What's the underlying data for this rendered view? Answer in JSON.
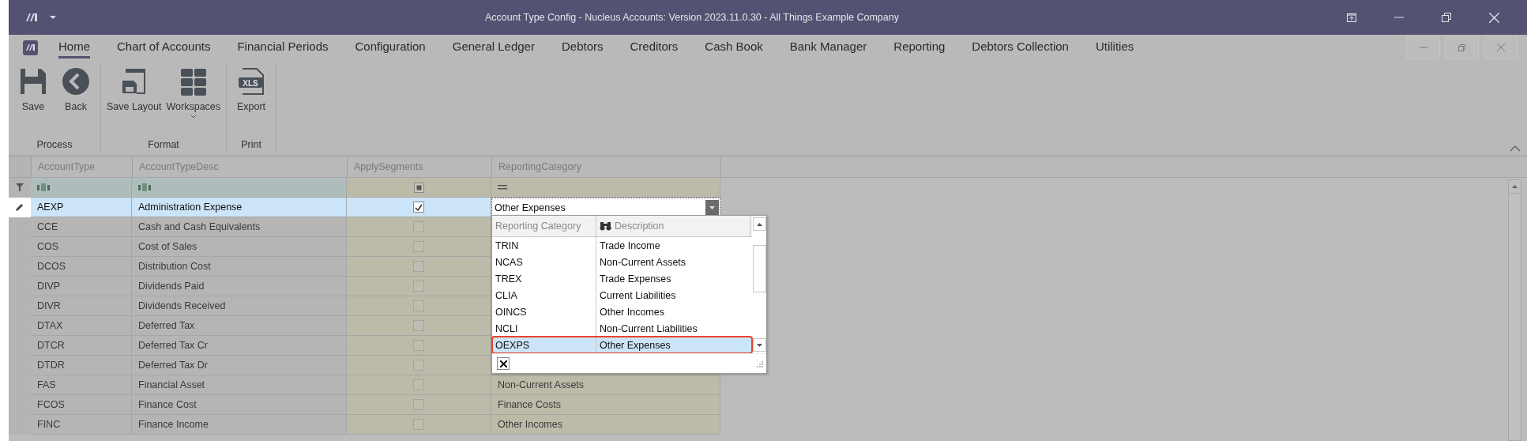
{
  "window": {
    "title": "Account Type Config - Nucleus Accounts: Version 2023.11.0.30 - All Things Example Company"
  },
  "menu": {
    "tabs": [
      {
        "label": "Home",
        "selected": true
      },
      {
        "label": "Chart of Accounts",
        "selected": false
      },
      {
        "label": "Financial Periods",
        "selected": false
      },
      {
        "label": "Configuration",
        "selected": false
      },
      {
        "label": "General Ledger",
        "selected": false
      },
      {
        "label": "Debtors",
        "selected": false
      },
      {
        "label": "Creditors",
        "selected": false
      },
      {
        "label": "Cash Book",
        "selected": false
      },
      {
        "label": "Bank Manager",
        "selected": false
      },
      {
        "label": "Reporting",
        "selected": false
      },
      {
        "label": "Debtors Collection",
        "selected": false
      },
      {
        "label": "Utilities",
        "selected": false
      }
    ]
  },
  "ribbon": {
    "groups": [
      {
        "label": "Process",
        "buttons": [
          {
            "label": "Save",
            "kind": "save"
          },
          {
            "label": "Back",
            "kind": "back"
          }
        ]
      },
      {
        "label": "Format",
        "buttons": [
          {
            "label": "Save Layout",
            "kind": "layout"
          },
          {
            "label": "Workspaces",
            "kind": "workspaces",
            "dropdown": true
          }
        ]
      },
      {
        "label": "Print",
        "buttons": [
          {
            "label": "Export",
            "kind": "spreadsheet",
            "badge": "XLS"
          }
        ]
      }
    ]
  },
  "grid": {
    "columns": [
      {
        "label": "AccountType",
        "kind": "text"
      },
      {
        "label": "AccountTypeDesc",
        "kind": "text"
      },
      {
        "label": "ApplySegments",
        "kind": "check"
      },
      {
        "label": "ReportingCategory",
        "kind": "lookup"
      }
    ],
    "rows": [
      {
        "account_type": "AEXP",
        "description": "Administration Expense",
        "apply_segments": true,
        "reporting_category": "Other Expenses",
        "selected": true,
        "editing": true
      },
      {
        "account_type": "CCE",
        "description": "Cash and Cash Equivalents",
        "apply_segments": false,
        "selected": false,
        "editing": false
      },
      {
        "account_type": "COS",
        "description": "Cost of Sales",
        "apply_segments": false,
        "selected": false,
        "editing": false
      },
      {
        "account_type": "DCOS",
        "description": "Distribution Cost",
        "apply_segments": false,
        "selected": false,
        "editing": false
      },
      {
        "account_type": "DIVP",
        "description": "Dividends Paid",
        "apply_segments": false,
        "selected": false,
        "editing": false
      },
      {
        "account_type": "DIVR",
        "description": "Dividends Received",
        "apply_segments": false,
        "selected": false,
        "editing": false
      },
      {
        "account_type": "DTAX",
        "description": "Deferred Tax",
        "apply_segments": false,
        "selected": false,
        "editing": false
      },
      {
        "account_type": "DTCR",
        "description": "Deferred Tax Cr",
        "apply_segments": false,
        "selected": false,
        "editing": false
      },
      {
        "account_type": "DTDR",
        "description": "Deferred Tax Dr",
        "apply_segments": false,
        "selected": false,
        "editing": false
      },
      {
        "account_type": "FAS",
        "description": "Financial Asset",
        "apply_segments": false,
        "reporting_category": "Non-Current Assets",
        "selected": false,
        "editing": false
      },
      {
        "account_type": "FCOS",
        "description": "Finance Cost",
        "apply_segments": false,
        "reporting_category": "Finance Costs",
        "selected": false,
        "editing": false
      },
      {
        "account_type": "FINC",
        "description": "Finance Income",
        "apply_segments": false,
        "reporting_category": "Other Incomes",
        "selected": false,
        "editing": false
      }
    ]
  },
  "dropdown": {
    "columns": [
      "Reporting Category",
      "Description"
    ],
    "items": [
      {
        "code": "TRIN",
        "description": "Trade Income",
        "selected": false
      },
      {
        "code": "NCAS",
        "description": "Non-Current Assets",
        "selected": false
      },
      {
        "code": "TREX",
        "description": "Trade Expenses",
        "selected": false
      },
      {
        "code": "CLIA",
        "description": "Current Liabilities",
        "selected": false
      },
      {
        "code": "OINCS",
        "description": "Other Incomes",
        "selected": false
      },
      {
        "code": "NCLI",
        "description": "Non-Current Liabilities",
        "selected": false
      },
      {
        "code": "OEXPS",
        "description": "Other Expenses",
        "selected": true
      }
    ]
  }
}
